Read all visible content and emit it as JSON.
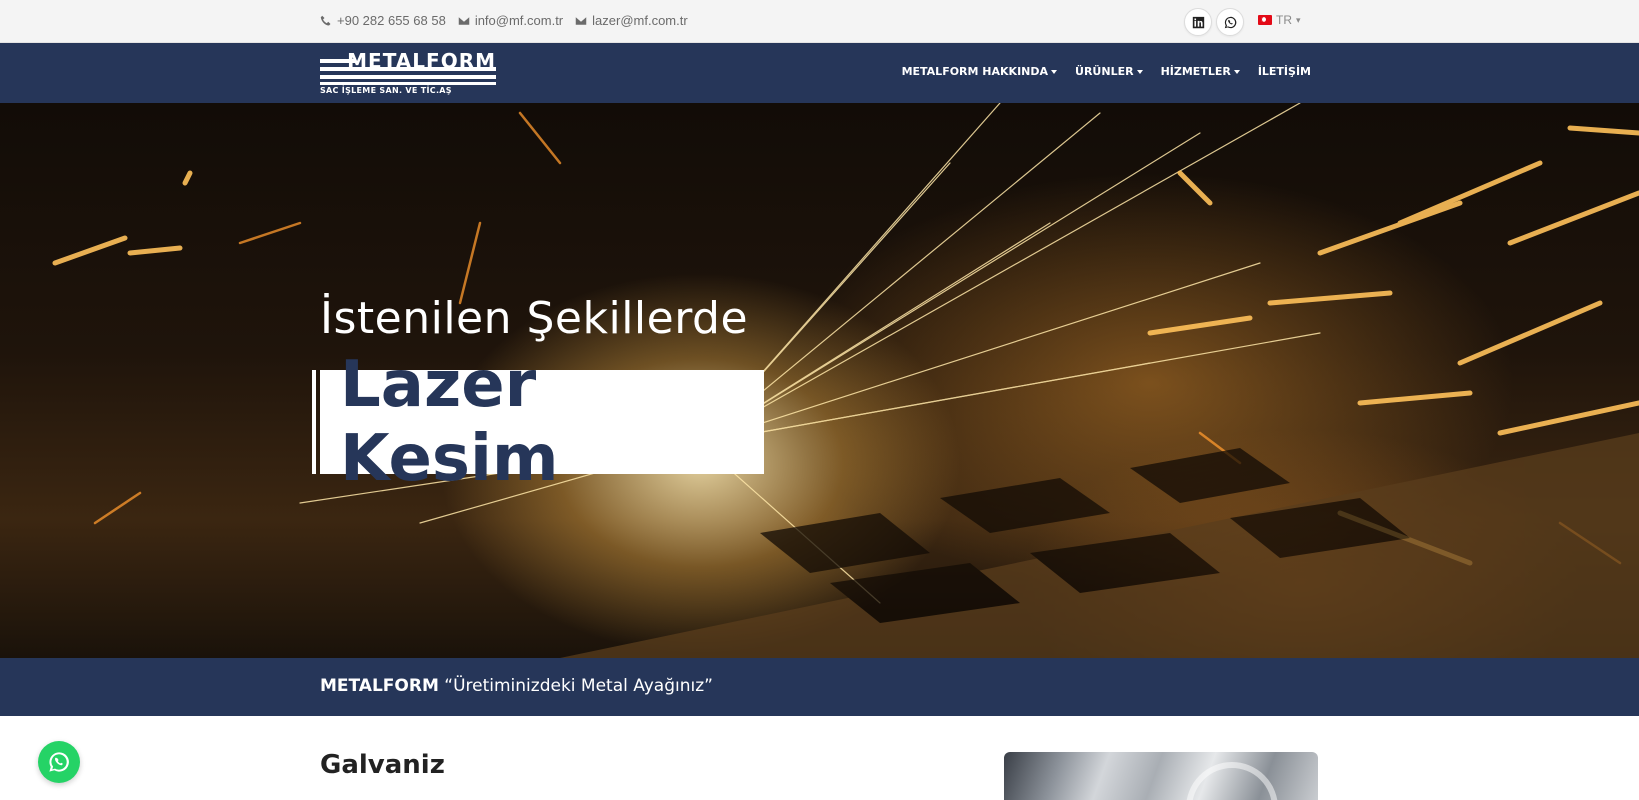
{
  "topbar": {
    "phone": "+90 282 655 68 58",
    "email_info": "info@mf.com.tr",
    "email_laser": "lazer@mf.com.tr",
    "social": [
      "linkedin-icon",
      "whatsapp-icon"
    ],
    "language": "TR"
  },
  "navbar": {
    "logo_word": "METALFORM",
    "logo_sub": "SAC İŞLEME SAN. VE TİC.AŞ",
    "menu": [
      {
        "label": "METALFORM HAKKINDA",
        "dropdown": true
      },
      {
        "label": "ÜRÜNLER",
        "dropdown": true
      },
      {
        "label": "HİZMETLER",
        "dropdown": true
      },
      {
        "label": "İLETİŞİM",
        "dropdown": false
      }
    ]
  },
  "hero": {
    "kicker": "İstenilen Şekillerde",
    "headline": "Lazer Kesim"
  },
  "slogan": {
    "brand": "METALFORM",
    "text": "“Üretiminizdeki Metal Ayağınız”"
  },
  "content": {
    "section_title": "Galvaniz"
  },
  "colors": {
    "navy": "#263659",
    "topbar_bg": "#f4f4f4",
    "whatsapp": "#25d366"
  }
}
